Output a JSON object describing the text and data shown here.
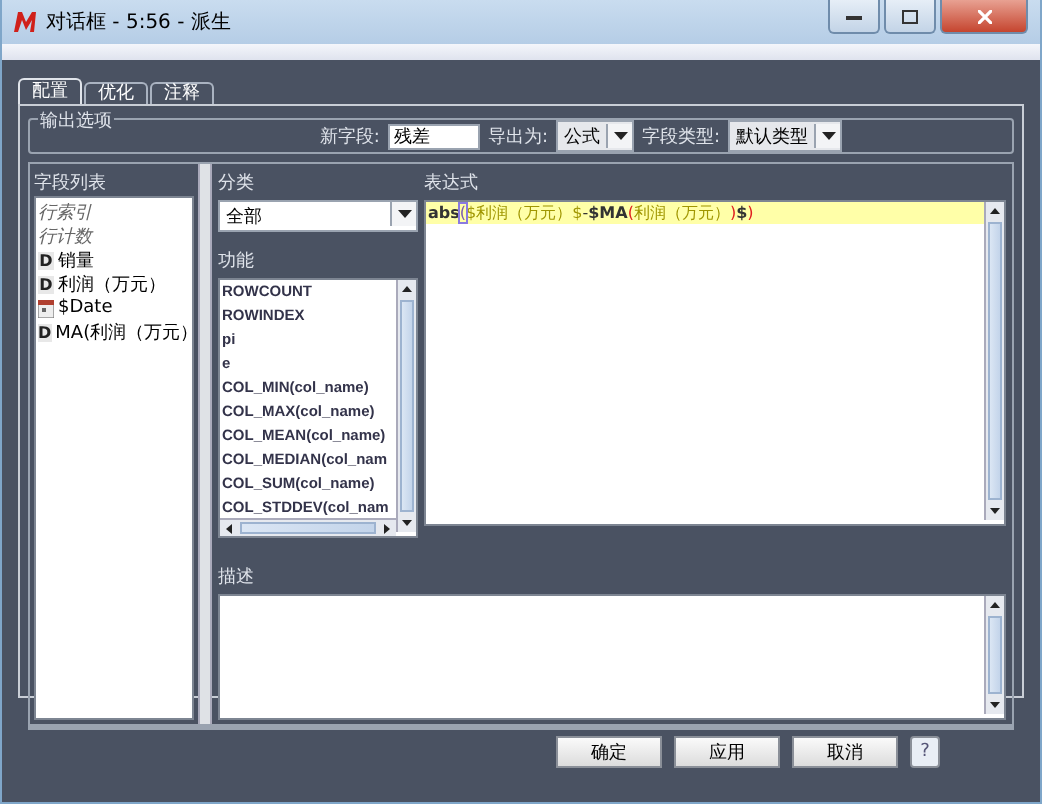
{
  "window": {
    "title": "对话框 - 5:56 - 派生"
  },
  "tabs": [
    {
      "label": "配置",
      "selected": true
    },
    {
      "label": "优化",
      "selected": false
    },
    {
      "label": "注释",
      "selected": false
    }
  ],
  "output_options": {
    "title": "输出选项",
    "new_field_label": "新字段:",
    "new_field_value": "残差",
    "export_label": "导出为:",
    "export_value": "公式",
    "type_label": "字段类型:",
    "type_value": "默认类型"
  },
  "field_list": {
    "title": "字段列表",
    "items": [
      {
        "label": "行索引",
        "kind": "virtual"
      },
      {
        "label": "行计数",
        "kind": "virtual"
      },
      {
        "label": "销量",
        "kind": "dimension",
        "badge": "D"
      },
      {
        "label": "利润（万元）",
        "kind": "dimension",
        "badge": "D"
      },
      {
        "label": "$Date",
        "kind": "date"
      },
      {
        "label": "MA(利润（万元）",
        "kind": "dimension",
        "badge": "D"
      }
    ]
  },
  "category": {
    "label": "分类",
    "value": "全部"
  },
  "functions": {
    "label": "功能",
    "items": [
      "ROWCOUNT",
      "ROWINDEX",
      "pi",
      "e",
      "COL_MIN(col_name)",
      "COL_MAX(col_name)",
      "COL_MEAN(col_name)",
      "COL_MEDIAN(col_nam",
      "COL_SUM(col_name)",
      "COL_STDDEV(col_nam"
    ]
  },
  "expression": {
    "label": "表达式",
    "tokens": [
      {
        "text": "abs",
        "kind": "function"
      },
      {
        "text": "(",
        "kind": "cursor"
      },
      {
        "text": "$利润（万元）$",
        "kind": "field"
      },
      {
        "text": "-",
        "kind": "operator"
      },
      {
        "text": "$MA",
        "kind": "function"
      },
      {
        "text": "(",
        "kind": "paren"
      },
      {
        "text": "利润（万元）",
        "kind": "field"
      },
      {
        "text": ")",
        "kind": "paren"
      },
      {
        "text": "$",
        "kind": "function"
      },
      {
        "text": ")",
        "kind": "paren"
      }
    ]
  },
  "description": {
    "label": "描述"
  },
  "buttons": [
    {
      "label": "确定",
      "kind": "text"
    },
    {
      "label": "应用",
      "kind": "text"
    },
    {
      "label": "取消",
      "kind": "text"
    },
    {
      "label": "?",
      "kind": "help"
    }
  ]
}
